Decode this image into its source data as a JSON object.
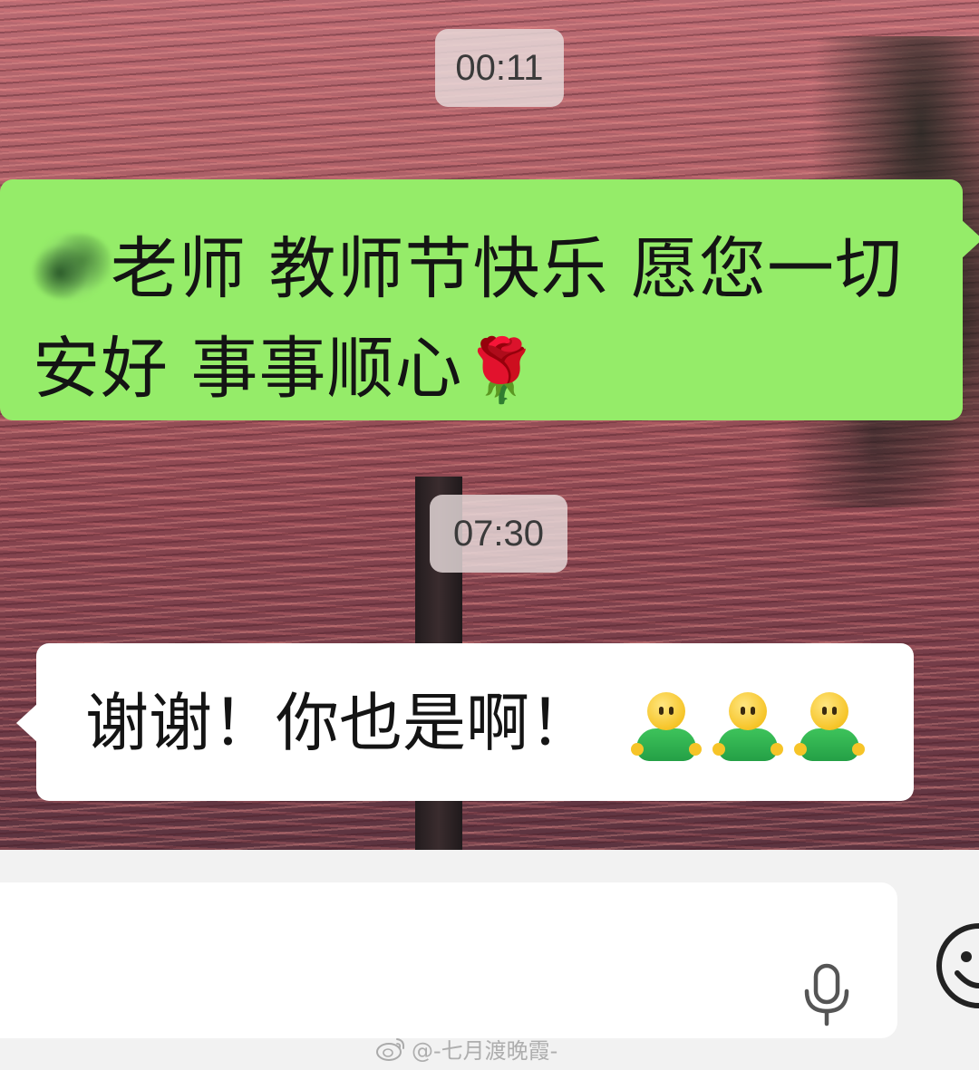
{
  "chat": {
    "timestamps": [
      "00:11",
      "07:30"
    ],
    "messages": [
      {
        "direction": "outgoing",
        "text": "老师 教师节快乐 愿您一切安好 事事顺心",
        "emoji": "🌹"
      },
      {
        "direction": "incoming",
        "text": "谢谢！你也是啊！",
        "emoji_icons": [
          "person-hug-icon",
          "person-hug-icon",
          "person-hug-icon"
        ]
      }
    ]
  },
  "input_bar": {
    "voice_icon": "microphone-icon",
    "emoji_icon": "smiley-icon"
  },
  "watermark": {
    "logo": "weibo-logo",
    "text": "@-七月渡晚霞-"
  },
  "colors": {
    "outgoing_bubble": "#95ec69",
    "incoming_bubble": "#ffffff",
    "input_bar_bg": "#f2f2f2"
  }
}
